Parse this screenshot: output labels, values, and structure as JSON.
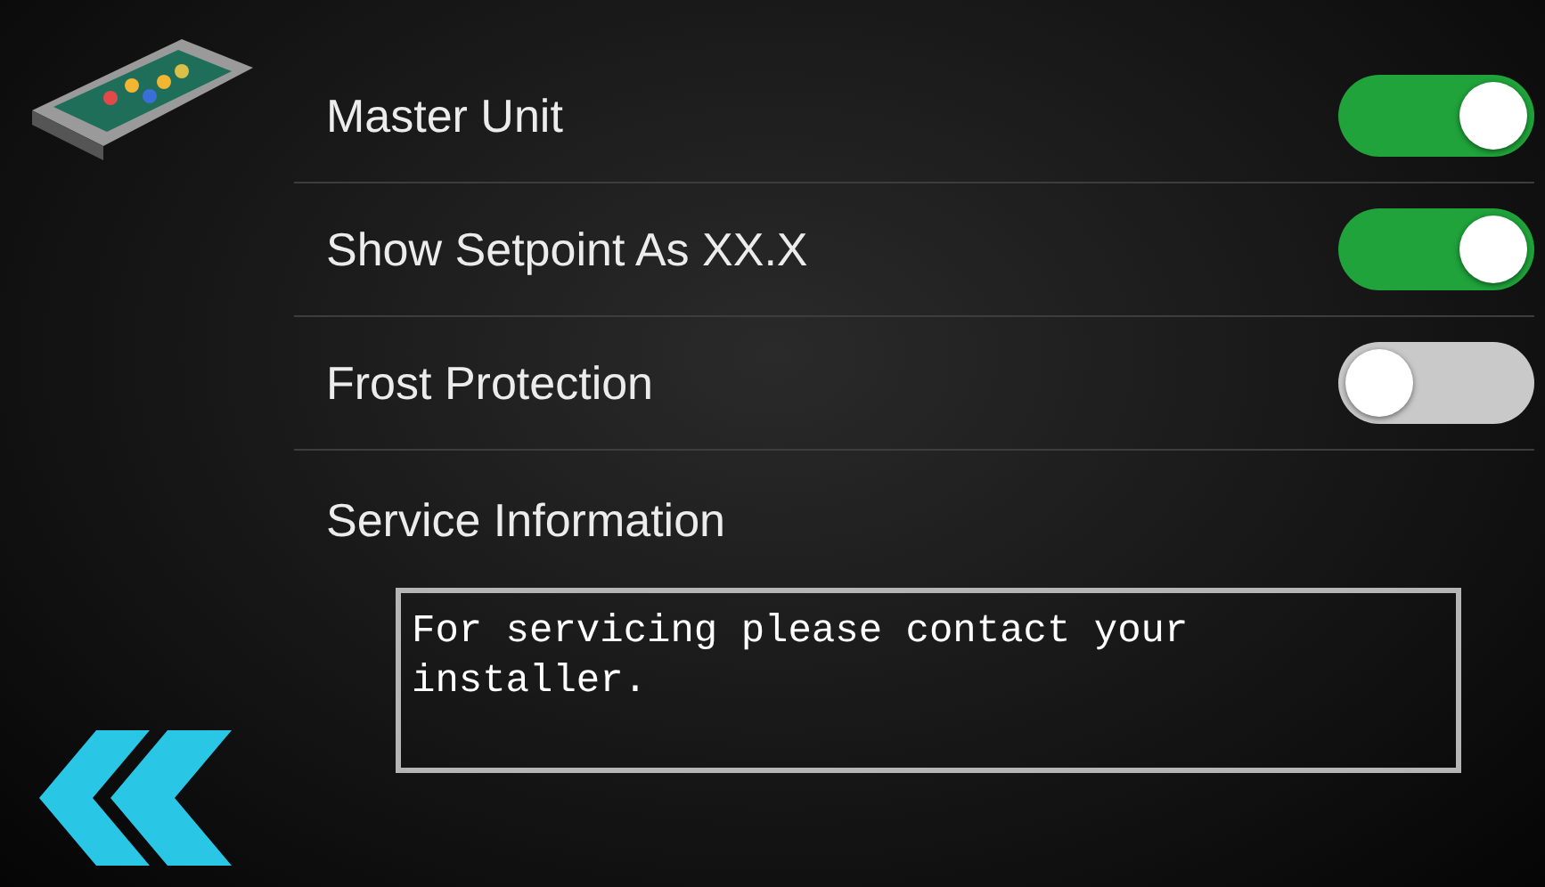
{
  "settings": [
    {
      "label": "Master Unit",
      "on": true
    },
    {
      "label": "Show Setpoint As XX.X",
      "on": true
    },
    {
      "label": "Frost Protection",
      "on": false
    }
  ],
  "service": {
    "label": "Service Information",
    "message": "For servicing please contact your installer."
  }
}
